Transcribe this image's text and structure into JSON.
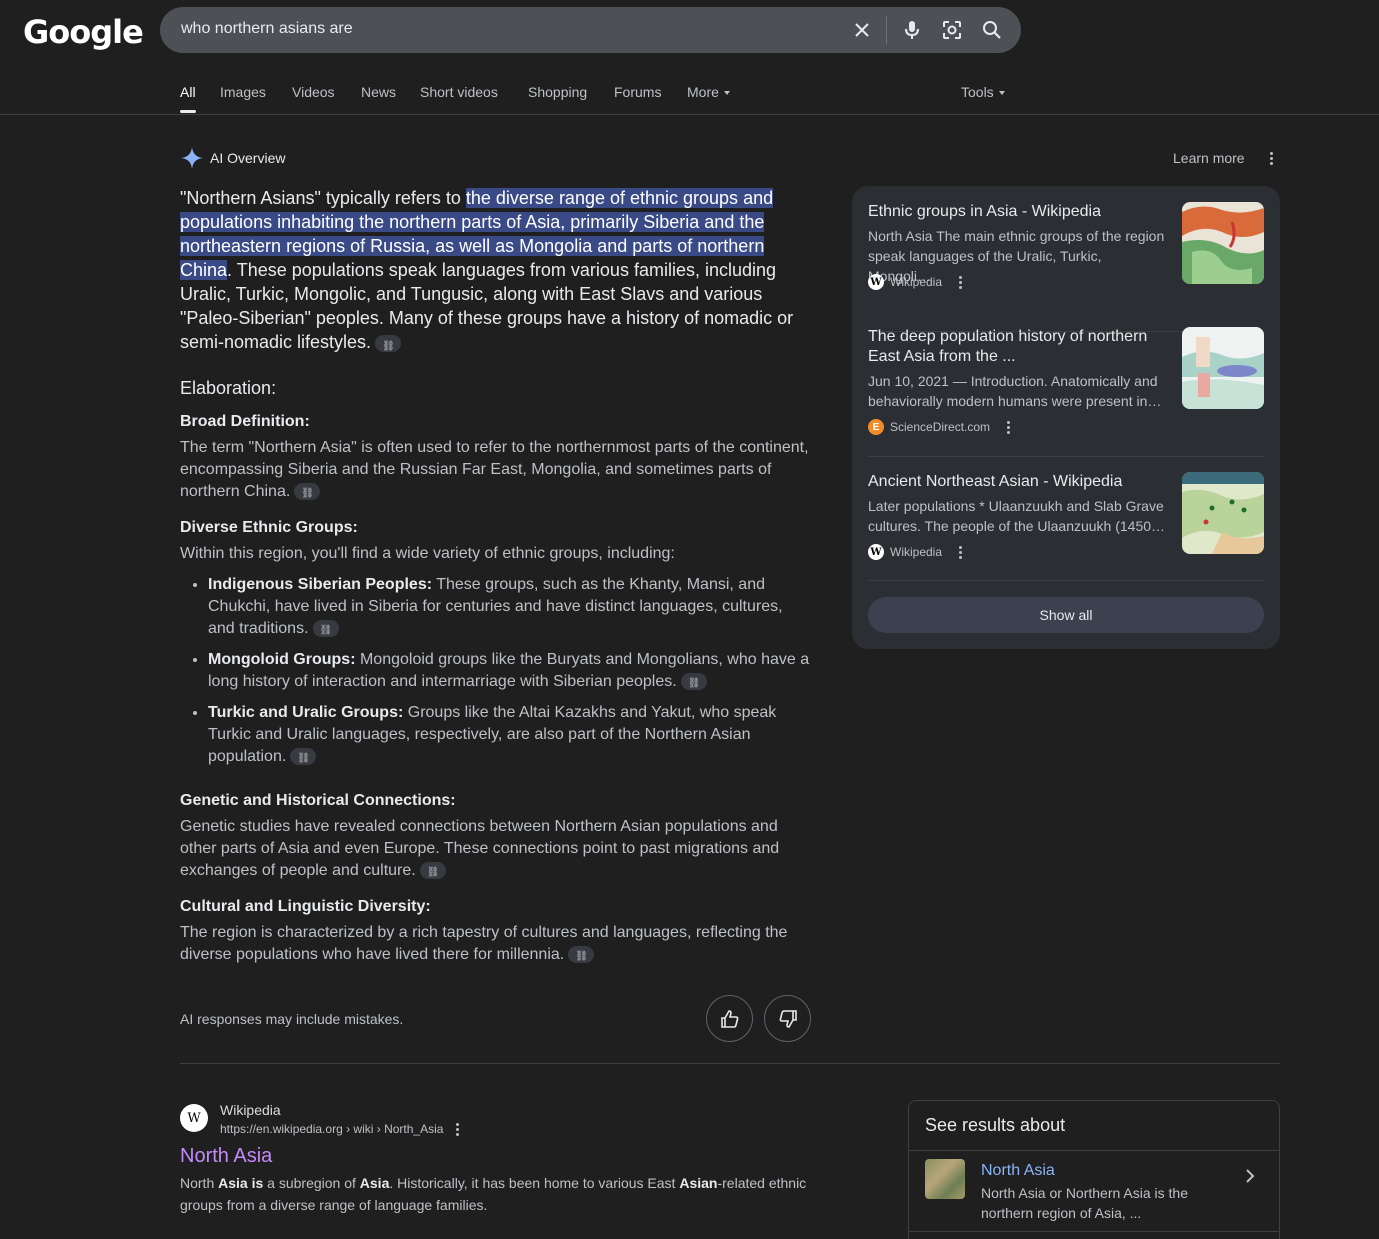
{
  "header": {
    "logo": "Google",
    "query": "who northern asians are"
  },
  "tabs": [
    {
      "label": "All",
      "active": true
    },
    {
      "label": "Images"
    },
    {
      "label": "Videos"
    },
    {
      "label": "News"
    },
    {
      "label": "Short videos"
    },
    {
      "label": "Shopping"
    },
    {
      "label": "Forums"
    },
    {
      "label": "More"
    }
  ],
  "tools_label": "Tools",
  "ai_overview": {
    "title": "AI Overview",
    "learn_more": "Learn more",
    "lead_pre": "\"Northern Asians\" typically refers to ",
    "lead_hl": "the diverse range of ethnic groups and populations inhabiting the northern parts of Asia, primarily Siberia and the northeastern regions of Russia, as well as Mongolia and parts of northern China",
    "lead_post": ". These populations speak languages from various families, including Uralic, Turkic, Mongolic, and Tungusic, along with East Slavs and various \"Paleo-Siberian\" peoples. Many of these groups have a history of nomadic or semi-nomadic lifestyles.",
    "elaboration": "Elaboration:",
    "broad_title": "Broad Definition:",
    "broad_text": "The term \"Northern Asia\" is often used to refer to the northernmost parts of the continent, encompassing Siberia and the Russian Far East, Mongolia, and sometimes parts of northern China.",
    "diverse_title": "Diverse Ethnic Groups:",
    "diverse_text": "Within this region, you'll find a wide variety of ethnic groups, including:",
    "bullets": [
      {
        "bold": "Indigenous Siberian Peoples:",
        "text": " These groups, such as the Khanty, Mansi, and Chukchi, have lived in Siberia for centuries and have distinct languages, cultures, and traditions."
      },
      {
        "bold": "Mongoloid Groups:",
        "text": " Mongoloid groups like the Buryats and Mongolians, who have a long history of interaction and intermarriage with Siberian peoples."
      },
      {
        "bold": "Turkic and Uralic Groups:",
        "text": " Groups like the Altai Kazakhs and Yakut, who speak Turkic and Uralic languages, respectively, are also part of the Northern Asian population."
      }
    ],
    "genetic_title": "Genetic and Historical Connections:",
    "genetic_text": "Genetic studies have revealed connections between Northern Asian populations and other parts of Asia and even Europe. These connections point to past migrations and exchanges of people and culture.",
    "cultural_title": "Cultural and Linguistic Diversity:",
    "cultural_text": "The region is characterized by a rich tapestry of cultures and languages, reflecting the diverse populations who have lived there for millennia.",
    "disclaimer": "AI responses may include mistakes."
  },
  "sources": [
    {
      "title": "Ethnic groups in Asia - Wikipedia",
      "snippet": "North Asia The main ethnic groups of the region speak languages of the Uralic, Turkic, Mongoli…",
      "source": "Wikipedia",
      "fav": "W"
    },
    {
      "title": "The deep population history of northern East Asia from the ...",
      "snippet": "Jun 10, 2021 — Introduction. Anatomically and behaviorally modern humans were present in…",
      "source": "ScienceDirect.com",
      "fav": "E"
    },
    {
      "title": "Ancient Northeast Asian - Wikipedia",
      "snippet": "Later populations * Ulaanzuukh and Slab Grave cultures. The people of the Ulaanzuukh (1450…",
      "source": "Wikipedia",
      "fav": "W"
    }
  ],
  "show_all": "Show all",
  "result": {
    "site": "Wikipedia",
    "url": "https://en.wikipedia.org › wiki › North_Asia",
    "fav": "W",
    "title": "North Asia",
    "snippet": {
      "p1": "North ",
      "b1": "Asia is",
      "p2": " a subregion of ",
      "b2": "Asia",
      "p3": ". Historically, it has been home to various East ",
      "b3": "Asian",
      "p4": "-related ethnic groups from a diverse range of language families."
    }
  },
  "see_results": {
    "heading": "See results about",
    "name": "North Asia",
    "desc": "North Asia or Northern Asia is the northern region of Asia, ..."
  }
}
